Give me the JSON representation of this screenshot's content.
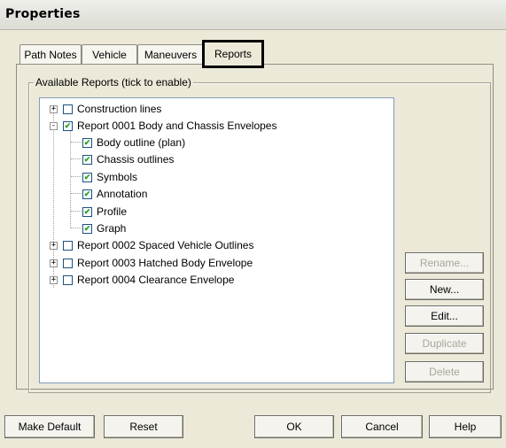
{
  "window": {
    "title": "Properties"
  },
  "tabs": [
    {
      "label": "Path Notes"
    },
    {
      "label": "Vehicle"
    },
    {
      "label": "Maneuvers"
    },
    {
      "label": "Reports"
    }
  ],
  "group": {
    "legend": "Available Reports (tick to enable)"
  },
  "tree": [
    {
      "label": "Construction lines",
      "checked": false,
      "expander": "+"
    },
    {
      "label": "Report 0001 Body and Chassis Envelopes",
      "checked": true,
      "expander": "-"
    },
    {
      "label": "Body outline (plan)",
      "checked": true
    },
    {
      "label": "Chassis outlines",
      "checked": true
    },
    {
      "label": "Symbols",
      "checked": true
    },
    {
      "label": "Annotation",
      "checked": true
    },
    {
      "label": "Profile",
      "checked": true
    },
    {
      "label": "Graph",
      "checked": true
    },
    {
      "label": "Report 0002 Spaced Vehicle Outlines",
      "checked": false,
      "expander": "+"
    },
    {
      "label": "Report 0003 Hatched Body Envelope",
      "checked": false,
      "expander": "+"
    },
    {
      "label": "Report 0004 Clearance Envelope",
      "checked": false,
      "expander": "+"
    }
  ],
  "side_buttons": {
    "rename": "Rename...",
    "new": "New...",
    "edit": "Edit...",
    "duplicate": "Duplicate",
    "delete": "Delete"
  },
  "bottom_buttons": {
    "make_default": "Make Default",
    "reset": "Reset",
    "ok": "OK",
    "cancel": "Cancel",
    "help": "Help"
  },
  "glyphs": {
    "check": "✔"
  }
}
